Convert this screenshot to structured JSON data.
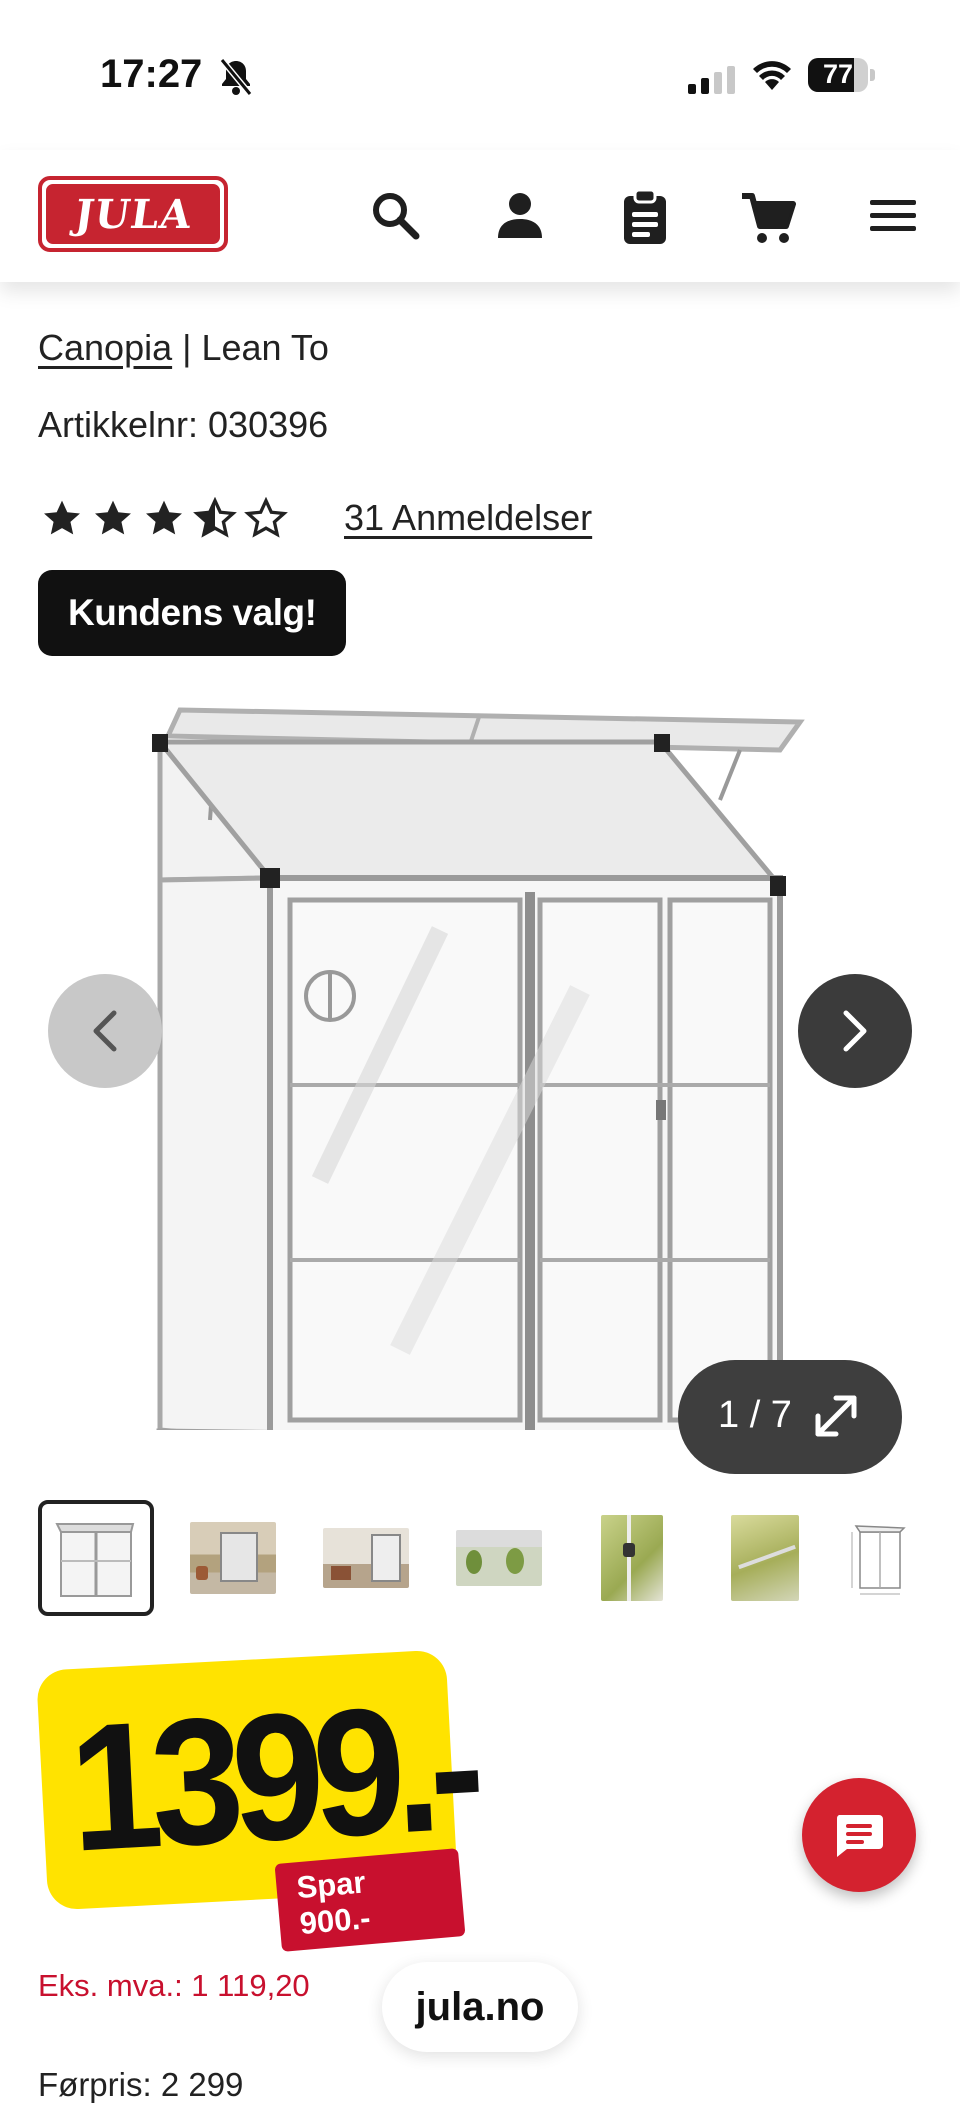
{
  "status_bar": {
    "time": "17:27",
    "battery_level": "77"
  },
  "header": {
    "logo_text": "JULA",
    "icons": [
      "search-icon",
      "account-icon",
      "clipboard-icon",
      "cart-icon",
      "menu-icon"
    ]
  },
  "product": {
    "brand": "Canopia",
    "separator": " | ",
    "name": "Lean To",
    "article_number": "Artikkelnr: 030396",
    "rating": 3.5,
    "rating_max": 5,
    "reviews_label": "31 Anmeldelser"
  },
  "gallery": {
    "badge": "Kundens valg!",
    "counter": "1 / 7",
    "thumbnail_count": 7,
    "active_thumbnail": 1
  },
  "pricing": {
    "price": "1399.-",
    "save_label": "Spar 900.-",
    "excl_vat": "Eks. mva.: 1 119,20",
    "previous_price": "Førpris: 2 299"
  },
  "browser": {
    "url": "jula.no"
  },
  "colors": {
    "brand_red": "#c62430",
    "price_yellow": "#ffe300",
    "save_red": "#c8102e"
  }
}
